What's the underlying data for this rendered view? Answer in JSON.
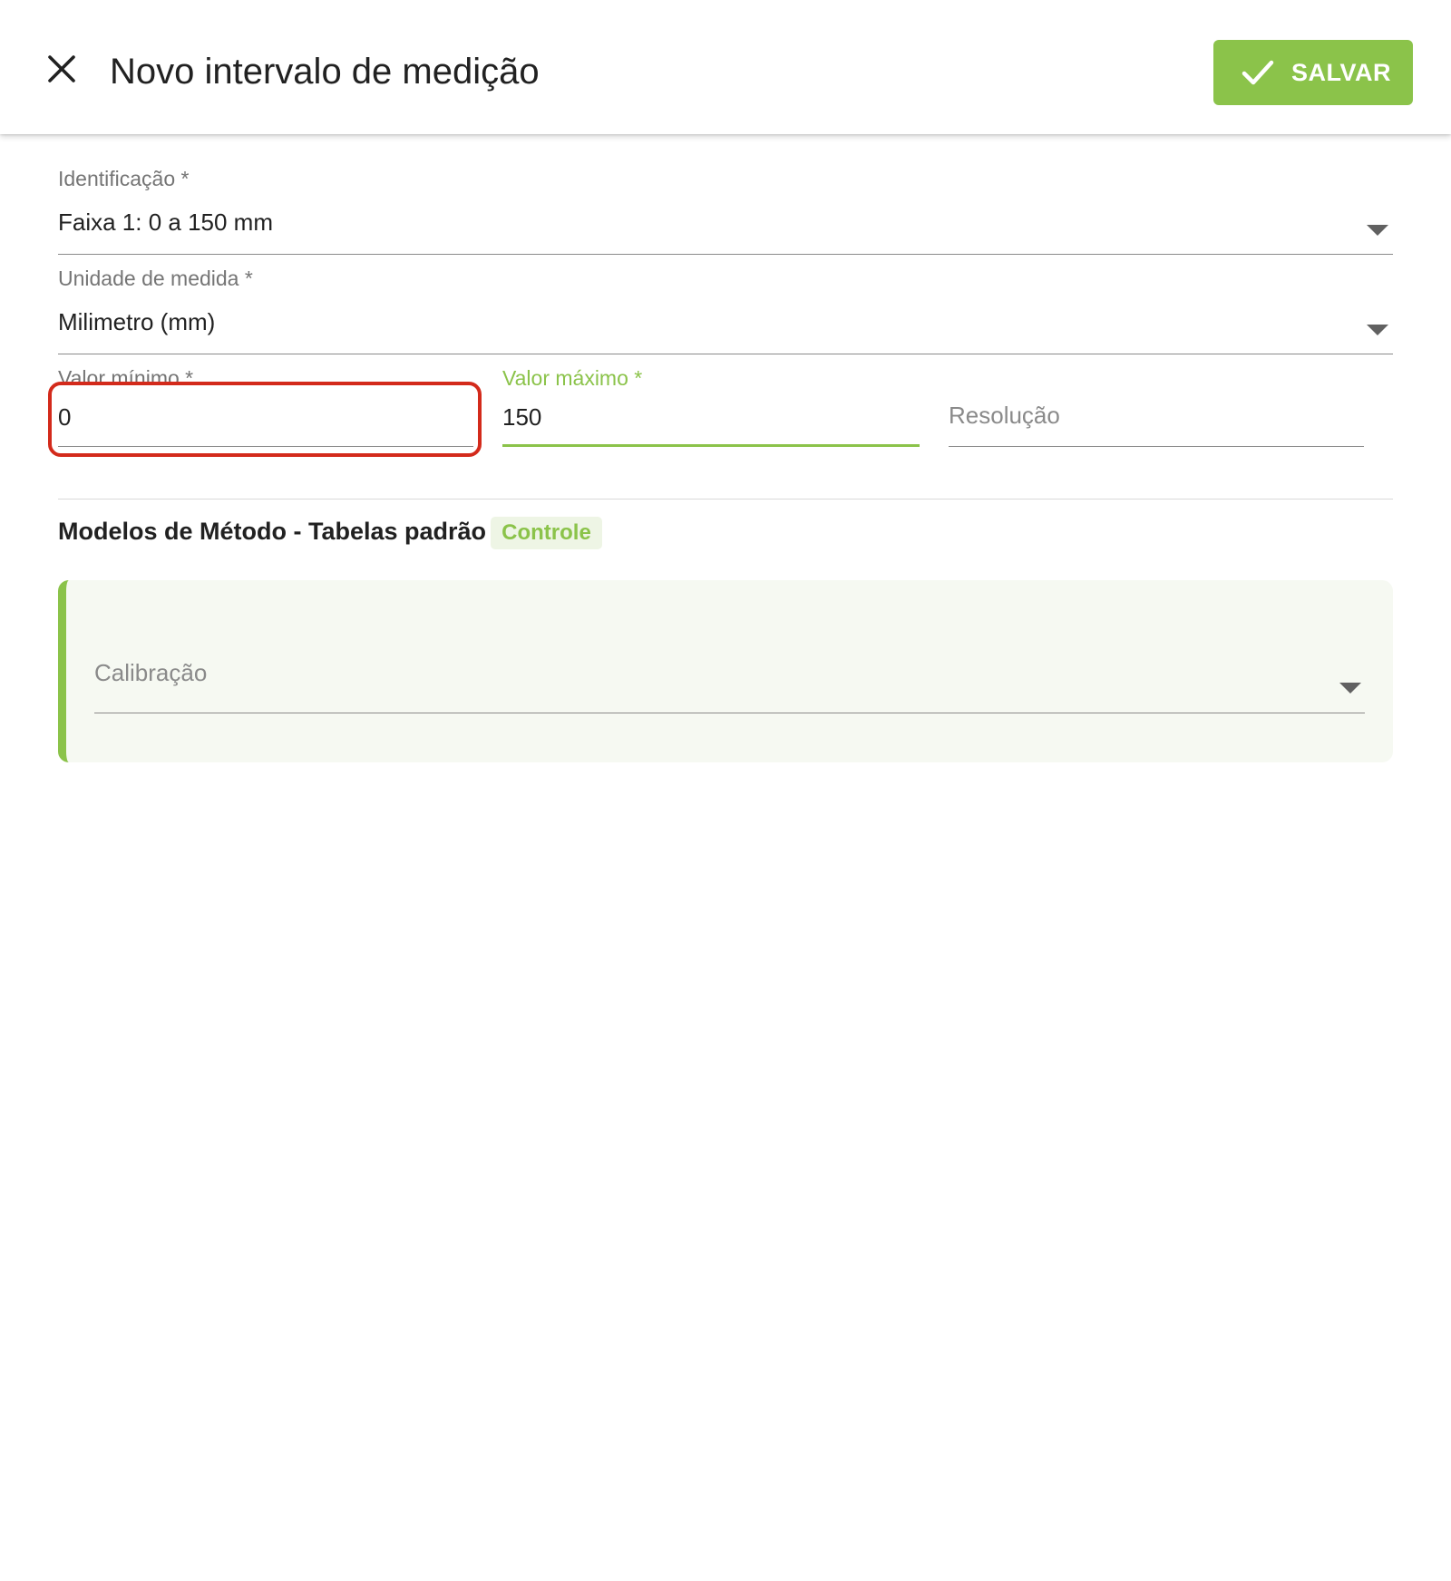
{
  "header": {
    "title": "Novo intervalo de medição",
    "save_label": "SALVAR",
    "close_icon": "close-icon",
    "save_icon": "check-icon"
  },
  "form": {
    "identificacao": {
      "label": "Identificação *",
      "value": "Faixa 1: 0 a 150 mm"
    },
    "unidade": {
      "label": "Unidade de medida *",
      "value": "Milimetro (mm)"
    },
    "valor_minimo": {
      "label": "Valor mínimo *",
      "value": "0"
    },
    "valor_maximo": {
      "label": "Valor máximo *",
      "value": "150"
    },
    "resolucao": {
      "placeholder": "Resolução",
      "value": ""
    }
  },
  "section": {
    "title": "Modelos de Método - Tabelas padrão",
    "chip": "Controle"
  },
  "method_card": {
    "calibracao": {
      "placeholder": "Calibração"
    }
  },
  "colors": {
    "accent": "#8bc34a",
    "focus_highlight": "#d32a1b",
    "chip_bg": "#eef5e5",
    "card_bg": "#f6f9f2"
  }
}
